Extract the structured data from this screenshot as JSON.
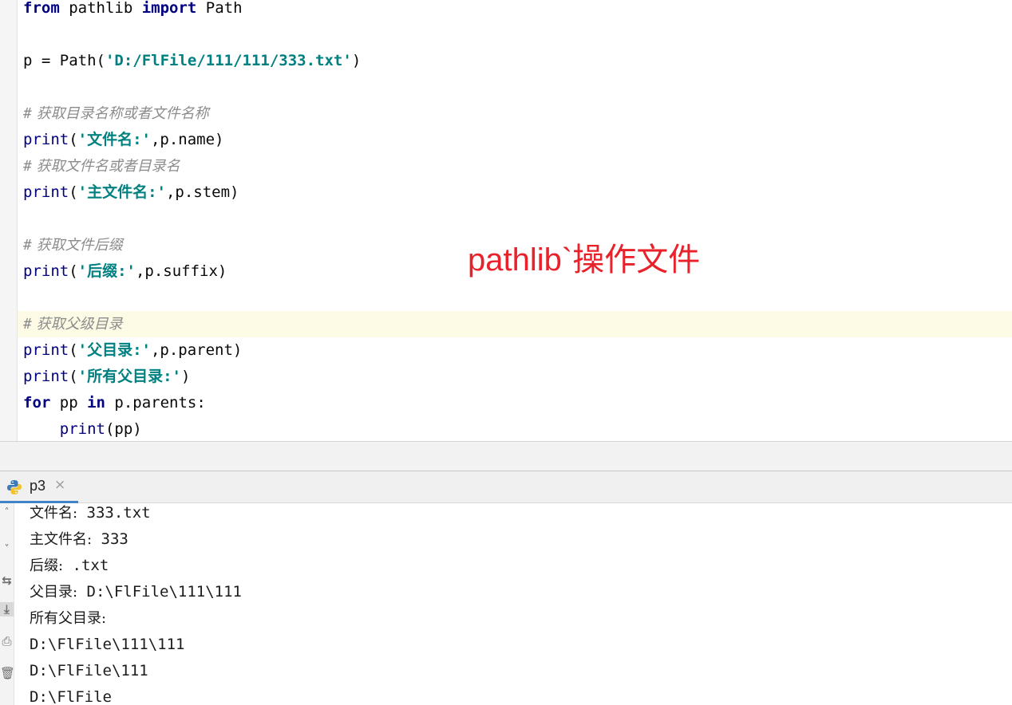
{
  "editor": {
    "import_line": {
      "kw1": "from",
      "module": " pathlib ",
      "kw2": "import",
      "name": " Path"
    },
    "path_line": {
      "var": "p = Path(",
      "arg": "'D:/FlFile/111/111/333.txt'",
      "close": ")"
    },
    "comment1": {
      "hash": "#",
      "text": " 获取目录名称或者文件名称"
    },
    "print_name": {
      "fn": "print",
      "open": "(",
      "str": "'文件名:'",
      "rest": ",p.name)"
    },
    "comment2": {
      "hash": "#",
      "text": " 获取文件名或者目录名"
    },
    "print_stem": {
      "fn": "print",
      "open": "(",
      "str": "'主文件名:'",
      "rest": ",p.stem)"
    },
    "comment3": {
      "hash": "#",
      "text": " 获取文件后缀"
    },
    "print_suffix": {
      "fn": "print",
      "open": "(",
      "str": "'后缀:'",
      "rest": ",p.suffix)"
    },
    "comment4": {
      "hash": "#",
      "text": " 获取父级目录"
    },
    "print_parent": {
      "fn": "print",
      "open": "(",
      "str": "'父目录:'",
      "rest": ",p.parent)"
    },
    "print_parents_label": {
      "fn": "print",
      "open": "(",
      "str": "'所有父目录:'",
      "rest": ")"
    },
    "for_line": {
      "kw1": "for",
      "var": " pp ",
      "kw2": "in",
      "rest": " p.parents:"
    },
    "print_pp": {
      "indent": "    ",
      "fn": "print",
      "rest": "(pp)"
    }
  },
  "annotation": "pathlib`操作文件",
  "run_panel": {
    "tab_label": "p3",
    "tab_close": "×",
    "icons": {
      "tab": "python-icon",
      "side": [
        "up-arrow-icon",
        "down-arrow-icon",
        "rerun-icon",
        "scroll-to-end-icon",
        "print-icon",
        "trash-icon"
      ]
    },
    "output": [
      {
        "label": "文件名:",
        "value": " 333.txt"
      },
      {
        "label": "主文件名:",
        "value": " 333"
      },
      {
        "label": "后缀:",
        "value": " .txt"
      },
      {
        "label": "父目录:",
        "value": " D:\\FlFile\\111\\111"
      },
      {
        "label": "所有父目录:",
        "value": ""
      },
      {
        "label": "",
        "value": "D:\\FlFile\\111\\111"
      },
      {
        "label": "",
        "value": "D:\\FlFile\\111"
      },
      {
        "label": "",
        "value": "D:\\FlFile"
      }
    ]
  },
  "colors": {
    "keyword": "#000080",
    "string": "#008080",
    "comment": "#8c8c8c",
    "annotation": "#e8212a",
    "current_line": "#fdfbe5",
    "tab_underline": "#4083c9"
  }
}
